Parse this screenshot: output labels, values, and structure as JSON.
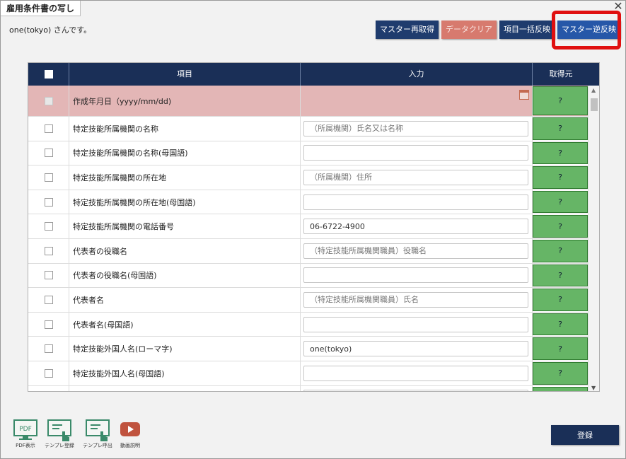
{
  "dialog": {
    "title": "雇用条件書の写し",
    "close": "✕",
    "user_text": "one(tokyo) さんです。"
  },
  "toolbar": {
    "master_reload": "マスター再取得",
    "data_clear": "データクリア",
    "bulk_apply": "項目一括反映",
    "master_reverse": "マスター逆反映"
  },
  "table": {
    "headers": {
      "item": "項目",
      "input": "入力",
      "source": "取得元"
    },
    "rows": [
      {
        "item": "作成年月日（yyyy/mm/dd)",
        "value": "",
        "placeholder": "",
        "source": "?",
        "error": true
      },
      {
        "item": "特定技能所属機関の名称",
        "value": "",
        "placeholder": "（所属機関）氏名又は名称",
        "source": "?"
      },
      {
        "item": "特定技能所属機関の名称(母国語)",
        "value": "",
        "placeholder": "",
        "source": "?"
      },
      {
        "item": "特定技能所属機関の所在地",
        "value": "",
        "placeholder": "（所属機関）住所",
        "source": "?"
      },
      {
        "item": "特定技能所属機関の所在地(母国語)",
        "value": "",
        "placeholder": "",
        "source": "?"
      },
      {
        "item": "特定技能所属機関の電話番号",
        "value": "06-6722-4900",
        "placeholder": "",
        "source": "?"
      },
      {
        "item": "代表者の役職名",
        "value": "",
        "placeholder": "（特定技能所属機関職員）役職名",
        "source": "?"
      },
      {
        "item": "代表者の役職名(母国語)",
        "value": "",
        "placeholder": "",
        "source": "?"
      },
      {
        "item": "代表者名",
        "value": "",
        "placeholder": "（特定技能所属機関職員）氏名",
        "source": "?"
      },
      {
        "item": "代表者名(母国語)",
        "value": "",
        "placeholder": "",
        "source": "?"
      },
      {
        "item": "特定技能外国人名(ローマ字)",
        "value": "one(tokyo)",
        "placeholder": "",
        "source": "?"
      },
      {
        "item": "特定技能外国人名(母国語)",
        "value": "",
        "placeholder": "",
        "source": "?"
      },
      {
        "item": "",
        "value": "",
        "placeholder": "",
        "source": "?"
      }
    ]
  },
  "bottom_icons": {
    "pdf_glyph": "PDF",
    "pdf": "PDF表示",
    "template_register": "テンプレ登録",
    "template_load": "テンプレ呼出",
    "video": "動画説明"
  },
  "footer": {
    "register": "登録"
  },
  "colors": {
    "header_navy": "#1a2f57",
    "source_green": "#66b566",
    "error_row": "#e3b6b6",
    "highlight_red": "#e01010"
  }
}
